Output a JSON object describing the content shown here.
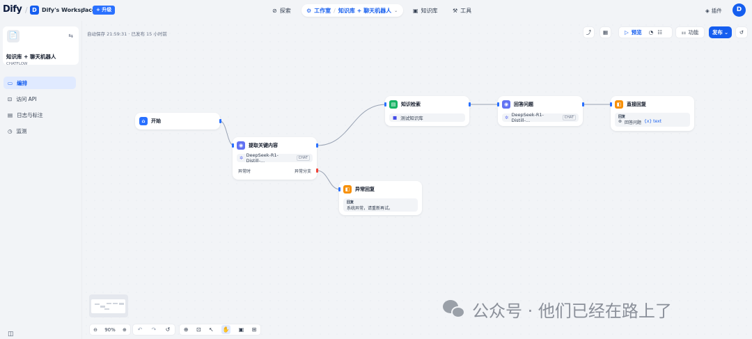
{
  "header": {
    "logo": "Dify",
    "workspace_initial": "D",
    "workspace_name": "Dify's Workspace",
    "upgrade_label": "+ 升级",
    "nav": {
      "explore": "探索",
      "studio": "工作室",
      "app_crumb": "知识库 + 聊天机器人",
      "knowledge": "知识库",
      "tools": "工具"
    },
    "plugins": "插件",
    "user_initial": "D"
  },
  "sidebar": {
    "app_name": "知识库 + 聊天机器人",
    "app_type": "CHATFLOW",
    "items": [
      {
        "label": "编排",
        "icon": "orchestrate-icon",
        "active": true
      },
      {
        "label": "访问 API",
        "icon": "api-icon",
        "active": false
      },
      {
        "label": "日志与标注",
        "icon": "log-icon",
        "active": false
      },
      {
        "label": "监测",
        "icon": "monitor-icon",
        "active": false
      }
    ]
  },
  "canvas": {
    "autosave": "自动保存 21:59:31 · 已发布 15 小时前",
    "toolbar": {
      "preview": "预览",
      "features": "功能",
      "publish": "发布"
    }
  },
  "nodes": {
    "start": {
      "title": "开始"
    },
    "extract": {
      "title": "提取关键内容",
      "model": "DeepSeek-R1-Distill-...",
      "model_tag": "CHAT",
      "error_left": "异常时",
      "error_right": "异常分支"
    },
    "knowledge": {
      "title": "知识检索",
      "dataset": "测试知识库"
    },
    "answer_q": {
      "title": "回答问题",
      "model": "DeepSeek-R1-Distill-...",
      "model_tag": "CHAT"
    },
    "direct": {
      "title": "直接回复",
      "section": "回复",
      "ref_node": "回答问题",
      "ref_var": "{x} text"
    },
    "error_reply": {
      "title": "异常回复",
      "section": "回复",
      "text": "系统异常，请重新再试。"
    }
  },
  "bottom": {
    "zoom": "90%"
  },
  "watermark": "公众号 · 他们已经在路上了",
  "colors": {
    "accent": "#155eef",
    "start": "#2970ff",
    "llm": "#6172f3",
    "knowledge": "#16b364",
    "answer": "#f79009"
  }
}
